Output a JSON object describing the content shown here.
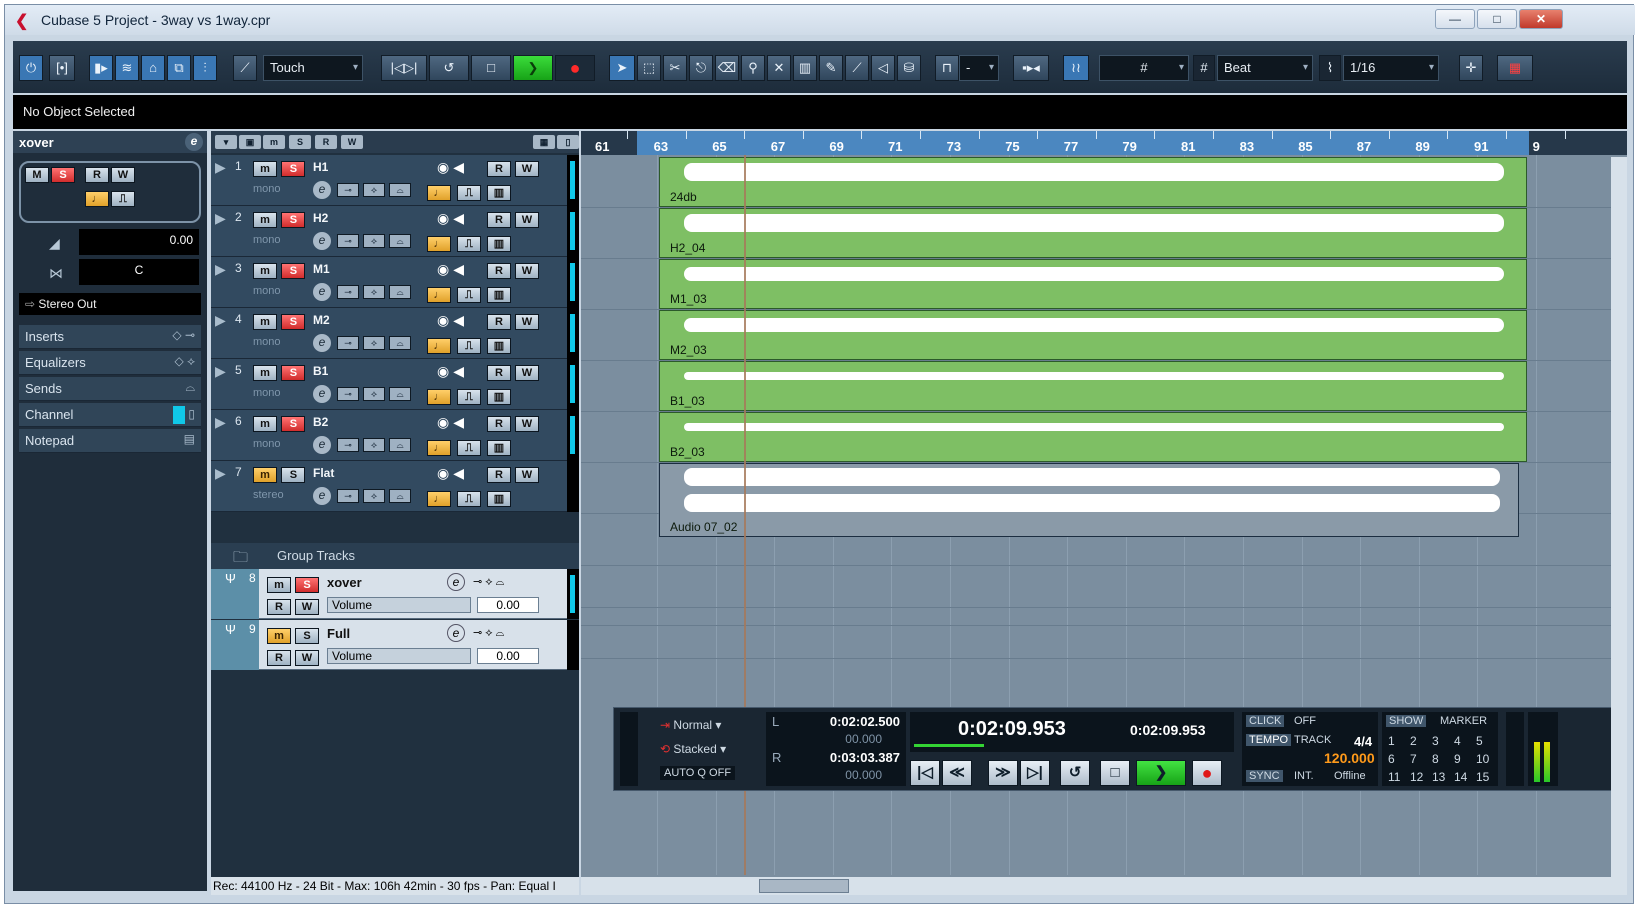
{
  "window": {
    "title": "Cubase 5 Project - 3way vs 1way.cpr",
    "minimize": "—",
    "maximize": "□",
    "close": "✕"
  },
  "toolbar": {
    "automation_mode": "Touch",
    "snap_type": "Beat",
    "quantize": "1/16",
    "grid_label": "#",
    "dash": "-"
  },
  "info_line": "No Object Selected",
  "inspector": {
    "track_name": "xover",
    "volume_value": "0.00",
    "pan_value": "C",
    "output": "Stereo Out",
    "sections": [
      "Inserts",
      "Equalizers",
      "Sends",
      "Channel",
      "Notepad"
    ],
    "m": "M",
    "s": "S",
    "r": "R",
    "w": "W",
    "e": "e"
  },
  "tracks": [
    {
      "num": "1",
      "name": "H1",
      "chan": "mono"
    },
    {
      "num": "2",
      "name": "H2",
      "chan": "mono"
    },
    {
      "num": "3",
      "name": "M1",
      "chan": "mono"
    },
    {
      "num": "4",
      "name": "M2",
      "chan": "mono"
    },
    {
      "num": "5",
      "name": "B1",
      "chan": "mono"
    },
    {
      "num": "6",
      "name": "B2",
      "chan": "mono"
    },
    {
      "num": "7",
      "name": "Flat",
      "chan": "stereo"
    }
  ],
  "track_buttons": {
    "m": "m",
    "s": "S",
    "r": "R",
    "w": "W",
    "e": "e"
  },
  "group_folder": "Group Tracks",
  "group_tracks": [
    {
      "num": "8",
      "name": "xover",
      "param": "Volume",
      "value": "0.00"
    },
    {
      "num": "9",
      "name": "Full",
      "param": "Volume",
      "value": "0.00"
    }
  ],
  "status_line": "Rec: 44100 Hz - 24 Bit - Max: 106h 42min - 30 fps - Pan: Equal I",
  "ruler": {
    "bars": [
      "61",
      "63",
      "65",
      "67",
      "69",
      "71",
      "73",
      "75",
      "77",
      "79",
      "81",
      "83",
      "85",
      "87",
      "89",
      "91",
      "9"
    ]
  },
  "clips": [
    {
      "name": "24db"
    },
    {
      "name": "H2_04"
    },
    {
      "name": "M1_03"
    },
    {
      "name": "M2_03"
    },
    {
      "name": "B1_03"
    },
    {
      "name": "B2_03"
    },
    {
      "name": "Audio 07_02"
    }
  ],
  "transport": {
    "cycle_mode": "Normal",
    "record_mode": "Stacked",
    "autoq_label": "AUTO Q",
    "autoq_value": "OFF",
    "left_locator": "0:02:02.500",
    "left_offset": "00.000",
    "right_locator": "0:03:03.387",
    "right_offset": "00.000",
    "primary_time": "0:02:09.953",
    "secondary_time": "0:02:09.953",
    "click_label": "CLICK",
    "click_value": "OFF",
    "tempo_label": "TEMPO",
    "tempo_mode": "TRACK",
    "signature": "4/4",
    "tempo": "120.000",
    "sync_label": "SYNC",
    "sync_source": "INT.",
    "sync_state": "Offline",
    "show_label": "SHOW",
    "marker_label": "MARKER",
    "markers": [
      "1",
      "2",
      "3",
      "4",
      "5",
      "6",
      "7",
      "8",
      "9",
      "10",
      "11",
      "12",
      "13",
      "14",
      "15"
    ]
  },
  "colors": {
    "clip_green": "#7ebf64",
    "solo_red": "#d12d2d",
    "play_green": "#17a317",
    "ruler_blue": "#4b87c0",
    "tempo_orange": "#ff9a1a"
  },
  "icons": {
    "activate": "power-icon",
    "constrain": "bracket-icon",
    "go_start": "go-to-start-icon",
    "cycle": "cycle-icon",
    "stop": "stop-icon",
    "play": "play-icon",
    "record": "record-icon",
    "pointer": "pointer-icon",
    "pencil": "pencil-icon",
    "zoom": "zoom-icon",
    "mute_tool": "mute-tool-icon",
    "snap": "grid-snap-icon",
    "color": "color-palette-icon"
  }
}
